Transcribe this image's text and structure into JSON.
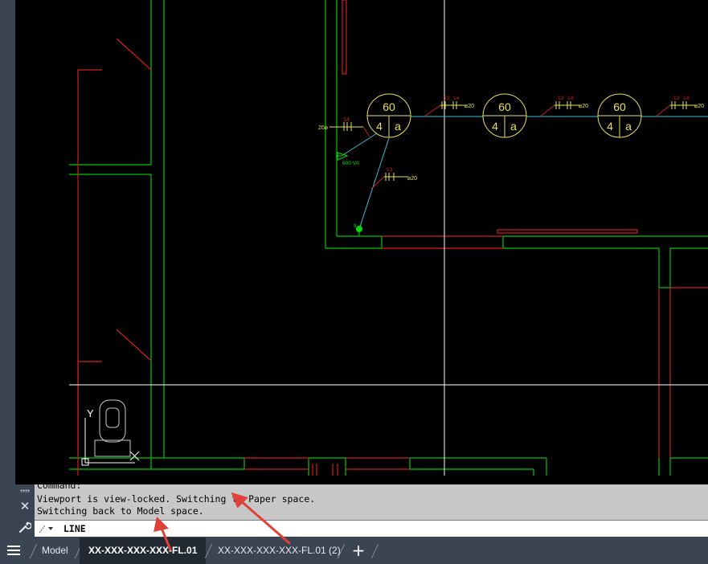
{
  "drawing": {
    "circuits": [
      {
        "rating": "60",
        "count": "4",
        "phase": "a"
      },
      {
        "rating": "60",
        "count": "4",
        "phase": "a"
      },
      {
        "rating": "60",
        "count": "4",
        "phase": "a"
      }
    ],
    "labels": {
      "load": "600 VA",
      "diameter_left": "20",
      "diameter_a": "20",
      "diameter_b": "20",
      "diameter_c": "20",
      "diameter_d": "20",
      "diameter_low": "20",
      "num_14a": "14",
      "num_13a": "13",
      "num_14b": "14",
      "num_13b": "13",
      "num_14c": "14",
      "num_13c": "13",
      "num_14d": "14",
      "num_13low": "13",
      "num_9": "9"
    },
    "ucs": {
      "y_label": "Y"
    }
  },
  "command": {
    "history": [
      "Command:",
      "Viewport is view-locked. Switching to Paper space.",
      "Switching back to Model space."
    ],
    "input_value": "LINE"
  },
  "tabs": {
    "model": "Model",
    "layout1": "XX-XXX-XXX-XXX-FL.01",
    "layout2": "XX-XXX-XXX-XXX-FL.01 (2)",
    "add_symbol": "+"
  },
  "colors": {
    "wall_green": "#00c800",
    "wall_red": "#d21e1e",
    "circuit_yellow": "#e8e05a",
    "wire_cyan": "#46b8d6",
    "crosshair": "#ffffff",
    "arrow_red": "#e0403a"
  }
}
